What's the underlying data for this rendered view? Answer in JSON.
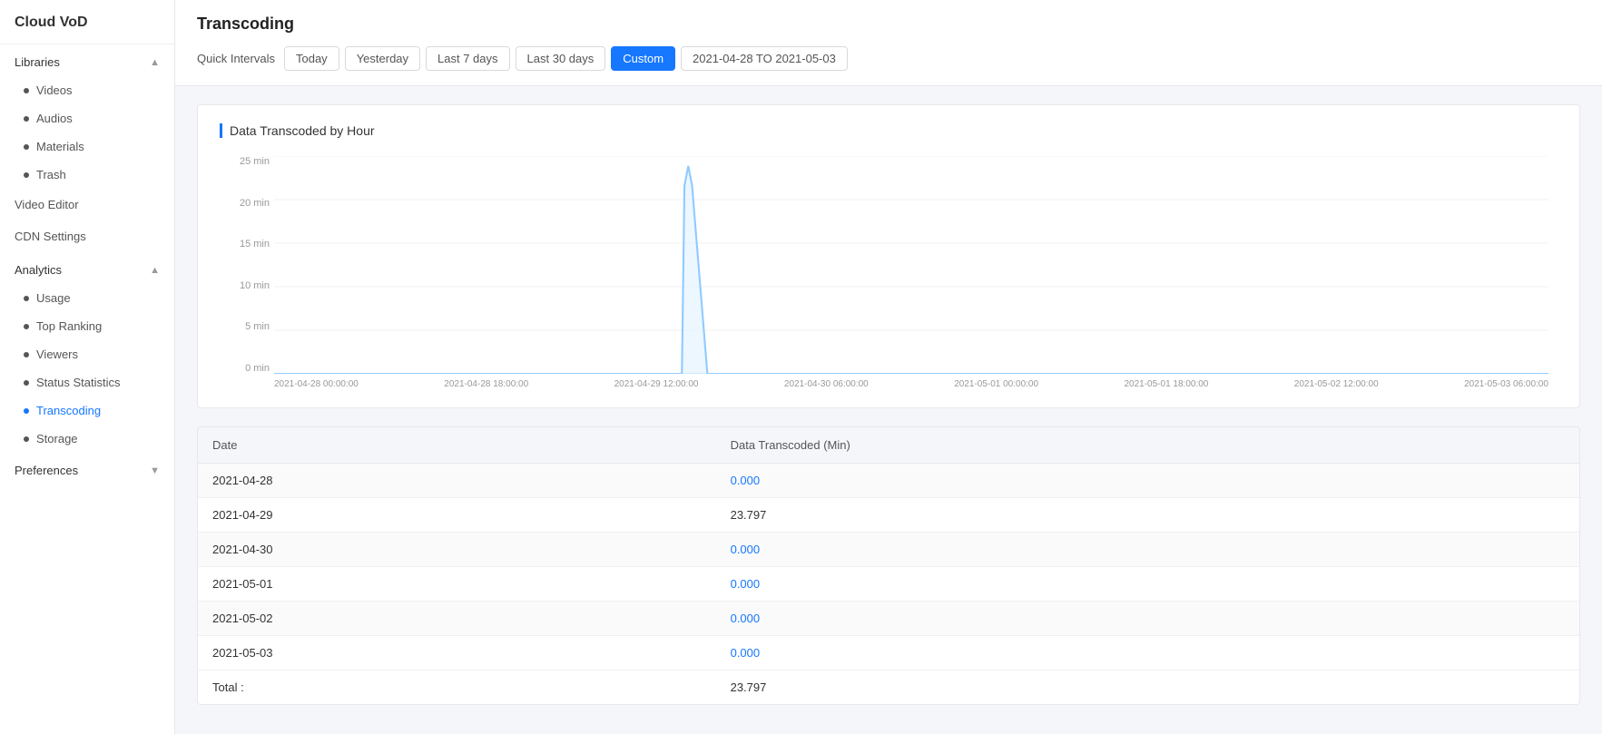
{
  "app": {
    "title": "Cloud VoD"
  },
  "sidebar": {
    "libraries_label": "Libraries",
    "items_libraries": [
      {
        "label": "Videos",
        "id": "videos"
      },
      {
        "label": "Audios",
        "id": "audios"
      },
      {
        "label": "Materials",
        "id": "materials"
      },
      {
        "label": "Trash",
        "id": "trash"
      }
    ],
    "video_editor_label": "Video Editor",
    "cdn_settings_label": "CDN Settings",
    "analytics_label": "Analytics",
    "items_analytics": [
      {
        "label": "Usage",
        "id": "usage"
      },
      {
        "label": "Top Ranking",
        "id": "top-ranking"
      },
      {
        "label": "Viewers",
        "id": "viewers"
      },
      {
        "label": "Status Statistics",
        "id": "status-statistics"
      },
      {
        "label": "Transcoding",
        "id": "transcoding",
        "active": true
      },
      {
        "label": "Storage",
        "id": "storage"
      }
    ],
    "preferences_label": "Preferences"
  },
  "header": {
    "page_title": "Transcoding",
    "quick_intervals_label": "Quick Intervals",
    "buttons": [
      {
        "label": "Today",
        "id": "today",
        "active": false
      },
      {
        "label": "Yesterday",
        "id": "yesterday",
        "active": false
      },
      {
        "label": "Last 7 days",
        "id": "last7",
        "active": false
      },
      {
        "label": "Last 30 days",
        "id": "last30",
        "active": false
      },
      {
        "label": "Custom",
        "id": "custom",
        "active": true
      }
    ],
    "date_range": "2021-04-28 TO 2021-05-03"
  },
  "chart": {
    "title": "Data Transcoded by Hour",
    "y_labels": [
      "0 min",
      "5 min",
      "10 min",
      "15 min",
      "20 min",
      "25 min"
    ],
    "x_labels": [
      "2021-04-28 00:00:00",
      "2021-04-28 18:00:00",
      "2021-04-29 12:00:00",
      "2021-04-30 06:00:00",
      "2021-05-01 00:00:00",
      "2021-05-01 18:00:00",
      "2021-05-02 12:00:00",
      "2021-05-03 06:00:00"
    ],
    "spike_position_pct": 32.5,
    "spike_height_pct": 90
  },
  "table": {
    "col_date": "Date",
    "col_data": "Data Transcoded (Min)",
    "rows": [
      {
        "date": "2021-04-28",
        "value": "0.000",
        "is_zero": true
      },
      {
        "date": "2021-04-29",
        "value": "23.797",
        "is_zero": false
      },
      {
        "date": "2021-04-30",
        "value": "0.000",
        "is_zero": true
      },
      {
        "date": "2021-05-01",
        "value": "0.000",
        "is_zero": true
      },
      {
        "date": "2021-05-02",
        "value": "0.000",
        "is_zero": true
      },
      {
        "date": "2021-05-03",
        "value": "0.000",
        "is_zero": true
      }
    ],
    "total_label": "Total :",
    "total_value": "23.797"
  }
}
